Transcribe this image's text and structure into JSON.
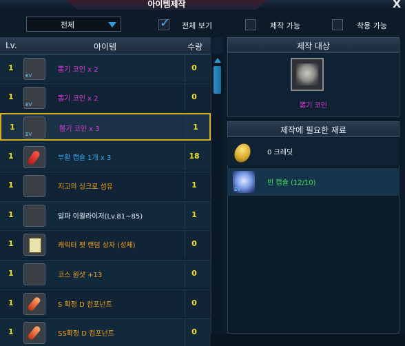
{
  "window": {
    "title": "아이템제작",
    "close_label": "X"
  },
  "filter": {
    "dropdown_value": "전체",
    "options": [
      {
        "label": "전체 보기",
        "checked": true
      },
      {
        "label": "제작 가능",
        "checked": false
      },
      {
        "label": "착용 가능",
        "checked": false
      }
    ]
  },
  "list": {
    "headers": {
      "lv": "Lv.",
      "item": "아이템",
      "qty": "수량"
    },
    "rows": [
      {
        "lv": "1",
        "name": "뽑기 코인 x 2",
        "qty": "0",
        "icon": "coin-icon",
        "name_color": "#e236d8",
        "selected": false
      },
      {
        "lv": "1",
        "name": "뽑기 코인 x 2",
        "qty": "0",
        "icon": "coin-icon",
        "name_color": "#e236d8",
        "selected": false
      },
      {
        "lv": "1",
        "name": "뽑기 코인 x 3",
        "qty": "1",
        "icon": "coin-icon",
        "name_color": "#e236d8",
        "selected": true
      },
      {
        "lv": "1",
        "name": "부활 캡슐 1개 x 3",
        "qty": "18",
        "icon": "capsule-icon",
        "name_color": "#39a6e8",
        "selected": false
      },
      {
        "lv": "1",
        "name": "지고의 싱크로 섬유",
        "qty": "1",
        "icon": "fiber-icon",
        "name_color": "#f4a21e",
        "selected": false
      },
      {
        "lv": "1",
        "name": "알파 이퀄라이저(Lv.81~85)",
        "qty": "1",
        "icon": "alpha-equalizer-icon",
        "name_color": "#e8eef4",
        "selected": false
      },
      {
        "lv": "1",
        "name": "캐릭터 팻 랜덤 상자 (성체)",
        "qty": "0",
        "icon": "box-icon",
        "name_color": "#f4a21e",
        "selected": false
      },
      {
        "lv": "1",
        "name": "코스 원샷 +13",
        "qty": "0",
        "icon": "shot-icon",
        "name_color": "#f4a21e",
        "selected": false
      },
      {
        "lv": "1",
        "name": "S 확정 D 컴포넌트",
        "qty": "0",
        "icon": "component-icon",
        "name_color": "#f4a21e",
        "selected": false
      },
      {
        "lv": "1",
        "name": "SS확정 D 컴포넌트",
        "qty": "0",
        "icon": "component-icon",
        "name_color": "#f4a21e",
        "selected": false
      }
    ]
  },
  "target": {
    "header": "제작 대상",
    "name": "뽑기 코인"
  },
  "materials": {
    "header": "제작에 필요한 재료",
    "items": [
      {
        "name": "0 크레딧",
        "icon": "credit-coin-icon",
        "color": "#e8eef4"
      },
      {
        "name": "빈 캡슐 (12/10)",
        "icon": "empty-capsule-icon",
        "color": "#3ee04a"
      }
    ]
  },
  "colors": {
    "selected_border": "#d4b21c",
    "level": "#f0e020",
    "accent": "#2e9bd6"
  }
}
